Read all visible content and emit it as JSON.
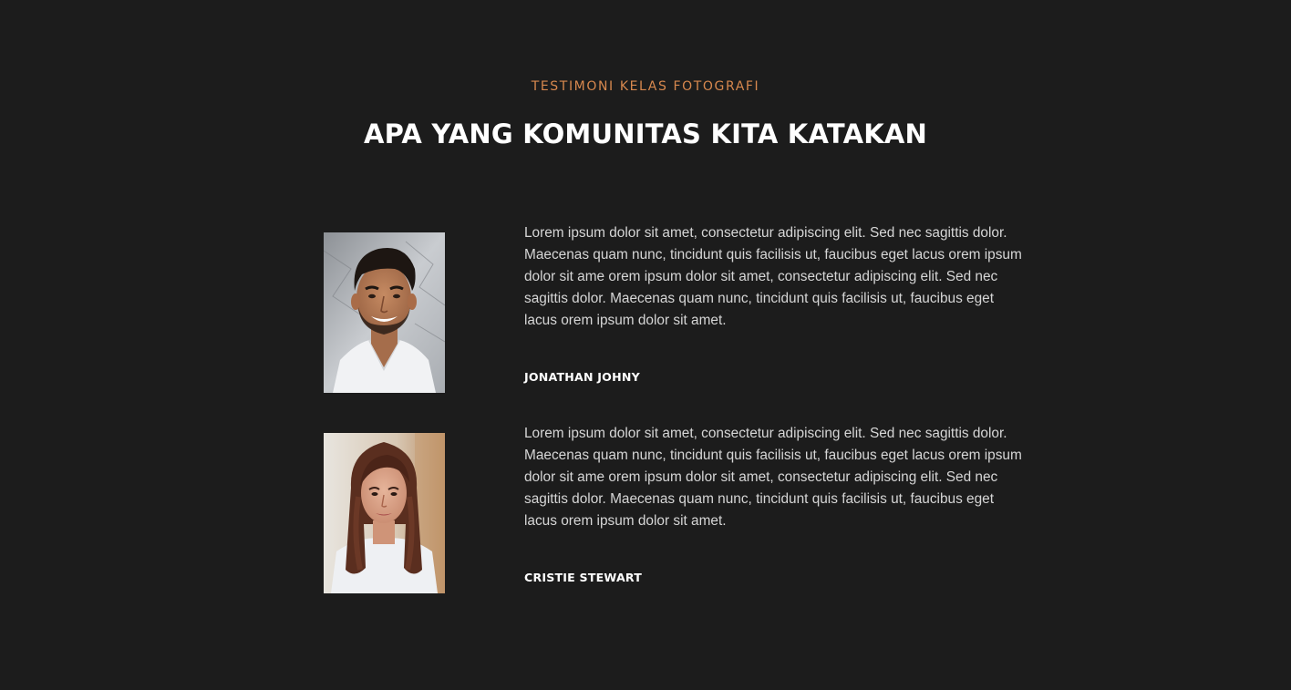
{
  "section": {
    "eyebrow": "TESTIMONI KELAS FOTOGRAFI",
    "heading": "APA YANG KOMUNITAS KITA KATAKAN"
  },
  "testimonials": [
    {
      "quote": "Lorem ipsum dolor sit amet, consectetur adipiscing elit. Sed nec sagittis dolor. Maecenas quam nunc, tincidunt quis facilisis ut, faucibus eget lacus orem ipsum dolor sit ame orem ipsum dolor sit amet, consectetur adipiscing elit. Sed nec sagittis dolor. Maecenas quam nunc, tincidunt quis facilisis ut, faucibus eget lacus orem ipsum dolor sit amet.",
      "name": "JONATHAN JOHNY"
    },
    {
      "quote": "Lorem ipsum dolor sit amet, consectetur adipiscing elit. Sed nec sagittis dolor. Maecenas quam nunc, tincidunt quis facilisis ut, faucibus eget lacus orem ipsum dolor sit ame orem ipsum dolor sit amet, consectetur adipiscing elit. Sed nec sagittis dolor. Maecenas quam nunc, tincidunt quis facilisis ut, faucibus eget lacus orem ipsum dolor sit amet.",
      "name": "CRISTIE STEWART"
    }
  ],
  "colors": {
    "background": "#1c1c1c",
    "accent": "#d7884e",
    "heading": "#ffffff",
    "body_text": "#d6d6d6"
  }
}
